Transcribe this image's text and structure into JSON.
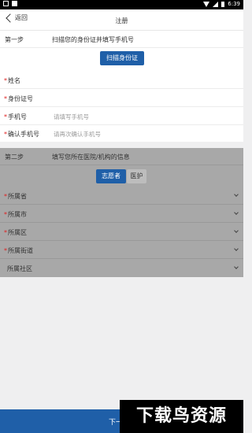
{
  "status": {
    "time": "6:39"
  },
  "nav": {
    "back": "返回",
    "title": "注册"
  },
  "step1": {
    "label": "第一步",
    "desc": "扫描您的身份证并填写手机号",
    "scan_button": "扫描身份证",
    "fields": [
      {
        "label": "姓名",
        "required": "*",
        "placeholder": ""
      },
      {
        "label": "身份证号",
        "required": "*",
        "placeholder": ""
      },
      {
        "label": "手机号",
        "required": "*",
        "placeholder": "请填写手机号"
      },
      {
        "label": "确认手机号",
        "required": "*",
        "placeholder": "请再次确认手机号"
      }
    ]
  },
  "step2": {
    "label": "第二步",
    "desc": "填写您所在医院/机构的信息",
    "toggle_active": "志愿者",
    "toggle_inactive": "医护",
    "selects": [
      {
        "label": "所属省",
        "required": "*"
      },
      {
        "label": "所属市",
        "required": "*"
      },
      {
        "label": "所属区",
        "required": "*"
      },
      {
        "label": "所属街道",
        "required": "*"
      },
      {
        "label": "所属社区",
        "required": ""
      }
    ]
  },
  "bottom": {
    "next_label": "下一"
  },
  "watermark": "下载鸟资源",
  "colors": {
    "primary": "#1f5fa8",
    "required": "#e02020",
    "overlay": "#a8a8a8"
  }
}
